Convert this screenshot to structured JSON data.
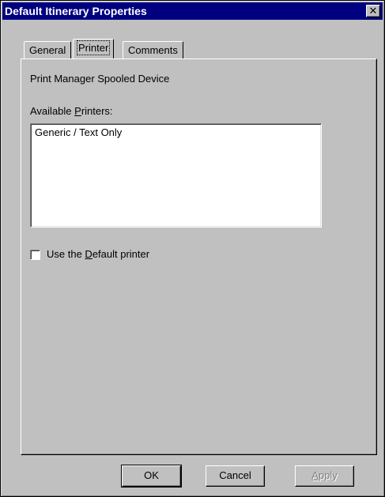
{
  "window": {
    "title": "Default Itinerary Properties",
    "close_glyph": "✕"
  },
  "tabs": [
    {
      "label": "General",
      "active": false
    },
    {
      "label": "Printer",
      "active": true
    },
    {
      "label": "Comments",
      "active": false
    }
  ],
  "printer_tab": {
    "device_label": "Print Manager Spooled Device",
    "available_label_prefix": "Available ",
    "available_label_mnemonic": "P",
    "available_label_suffix": "rinters:",
    "printers": [
      "Generic / Text Only"
    ],
    "default_checkbox": {
      "label_prefix": "Use the ",
      "label_mnemonic": "D",
      "label_suffix": "efault printer",
      "checked": false
    }
  },
  "buttons": {
    "ok": "OK",
    "cancel": "Cancel",
    "apply_mnemonic": "A",
    "apply_rest": "pply",
    "apply_enabled": false
  },
  "colors": {
    "title_bar": "#000080",
    "face": "#c0c0c0",
    "disabled_text": "#808080"
  }
}
